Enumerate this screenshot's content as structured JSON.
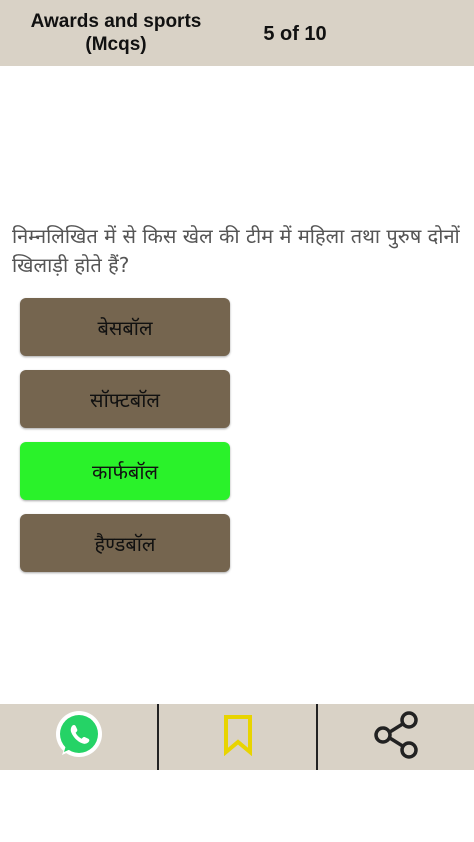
{
  "header": {
    "title": "Awards and sports\n(Mcqs)",
    "counter": "5 of 10"
  },
  "question": {
    "text": "निम्नलिखित में से किस खेल की टीम में महिला तथा पुरुष दोनों खिलाड़ी होते हैं?"
  },
  "options": [
    {
      "label": "बेसबॉल",
      "state": "default"
    },
    {
      "label": "सॉफ्टबॉल",
      "state": "default"
    },
    {
      "label": "कार्फबॉल",
      "state": "correct"
    },
    {
      "label": "हैण्डबॉल",
      "state": "default"
    }
  ],
  "bottom_bar": {
    "items": [
      {
        "icon": "whatsapp-icon"
      },
      {
        "icon": "bookmark-icon"
      },
      {
        "icon": "share-icon"
      }
    ]
  },
  "colors": {
    "header_bg": "#d9d2c6",
    "option_default": "#75654f",
    "option_correct": "#2af22a",
    "whatsapp_green": "#25d366",
    "bookmark_yellow": "#e8d400"
  }
}
